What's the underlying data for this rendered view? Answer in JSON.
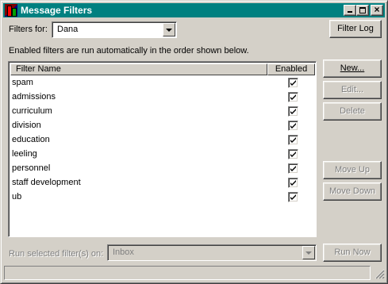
{
  "window": {
    "title": "Message Filters"
  },
  "toolbar": {
    "filters_for_label": "Filters for:",
    "filters_for_value": "Dana",
    "filter_log_label": "Filter Log"
  },
  "info_text": "Enabled filters are run automatically in the order shown below.",
  "list": {
    "columns": [
      "Filter Name",
      "Enabled"
    ],
    "rows": [
      {
        "name": "spam",
        "enabled": true
      },
      {
        "name": "admissions",
        "enabled": true
      },
      {
        "name": "curriculum",
        "enabled": true
      },
      {
        "name": "division",
        "enabled": true
      },
      {
        "name": "education",
        "enabled": true
      },
      {
        "name": "leeling",
        "enabled": true
      },
      {
        "name": "personnel",
        "enabled": true
      },
      {
        "name": "staff development",
        "enabled": true
      },
      {
        "name": "ub",
        "enabled": true
      }
    ]
  },
  "buttons": {
    "new": "New...",
    "edit": "Edit...",
    "delete": "Delete",
    "move_up": "Move Up",
    "move_down": "Move Down",
    "run_now": "Run Now"
  },
  "run_on": {
    "label": "Run selected filter(s) on:",
    "value": "Inbox"
  },
  "icons": {
    "app": "message-filters-app-icon",
    "minimize": "minimize-icon",
    "maximize": "maximize-icon",
    "close": "close-icon",
    "dropdown": "chevron-down-icon",
    "check": "checkmark-icon",
    "grip": "resize-grip-icon"
  },
  "colors": {
    "titlebar": "#008080",
    "face": "#d4d0c8",
    "disabled_text": "#808080"
  }
}
